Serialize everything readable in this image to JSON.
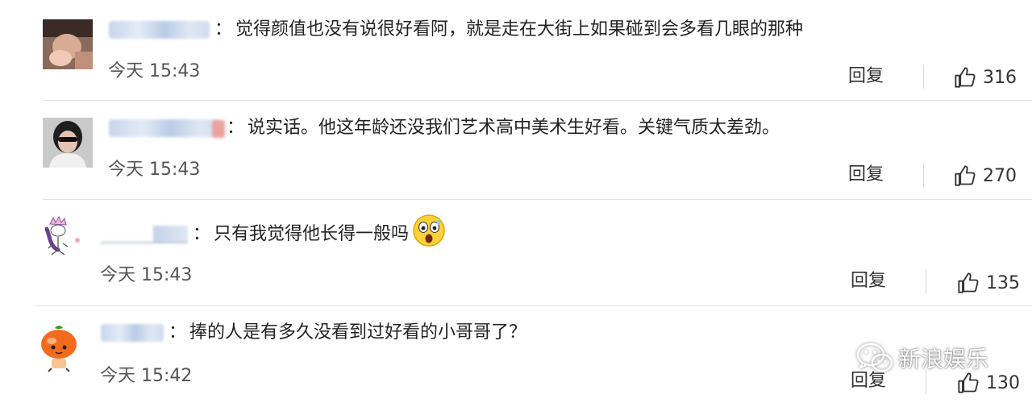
{
  "comments": [
    {
      "text": "觉得颜值也没有说很好看阿，就是走在大街上如果碰到会多看几眼的那种",
      "colon": "：",
      "time": "今天 15:43",
      "reply_label": "回复",
      "likes": "316",
      "avatar_icon": "user-avatar-photo"
    },
    {
      "text": "说实话。他这年龄还没我们艺术高中美术生好看。关键气质太差劲。",
      "colon": "：",
      "time": "今天 15:43",
      "reply_label": "回复",
      "likes": "270",
      "avatar_icon": "user-avatar-photo"
    },
    {
      "text": "只有我觉得他长得一般吗",
      "colon": "：",
      "emoji": "surprised-sweat-emoji",
      "time": "今天 15:43",
      "reply_label": "回复",
      "likes": "135",
      "avatar_icon": "user-avatar-drawing"
    },
    {
      "text": "捧的人是有多久没看到过好看的小哥哥了？",
      "colon": "：",
      "time": "今天 15:42",
      "reply_label": "回复",
      "likes": "130",
      "avatar_icon": "user-avatar-cartoon"
    }
  ],
  "watermark": {
    "text": "新浪娱乐",
    "icon": "wechat-icon"
  },
  "colors": {
    "text": "#222222",
    "muted": "#555555",
    "divider": "#e3e3e3",
    "blurred_name": "#c7d6ec"
  }
}
